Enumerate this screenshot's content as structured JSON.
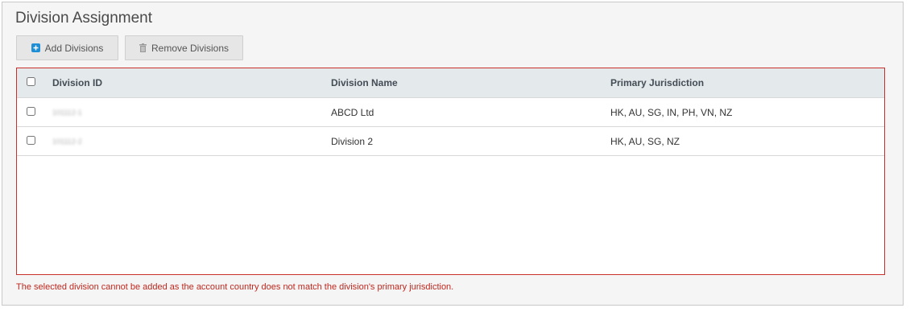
{
  "section": {
    "title": "Division Assignment"
  },
  "toolbar": {
    "add_label": "Add Divisions",
    "add_icon": "plus-square-icon",
    "remove_label": "Remove Divisions",
    "remove_icon": "trash-icon"
  },
  "table": {
    "columns": [
      "Division ID",
      "Division Name",
      "Primary Jurisdiction"
    ],
    "rows": [
      {
        "id": "101112-1",
        "name": "ABCD Ltd",
        "jurisdiction": "HK, AU, SG, IN, PH, VN, NZ",
        "selected": false
      },
      {
        "id": "101112-2",
        "name": "Division 2",
        "jurisdiction": "HK, AU, SG, NZ",
        "selected": false
      }
    ],
    "select_all": false
  },
  "error": {
    "message": "The selected division cannot be added as the account country does not match the division's primary jurisdiction."
  },
  "colors": {
    "accent": "#1e8fd6",
    "error": "#c9302c",
    "header_bg": "#e4e9ec"
  }
}
